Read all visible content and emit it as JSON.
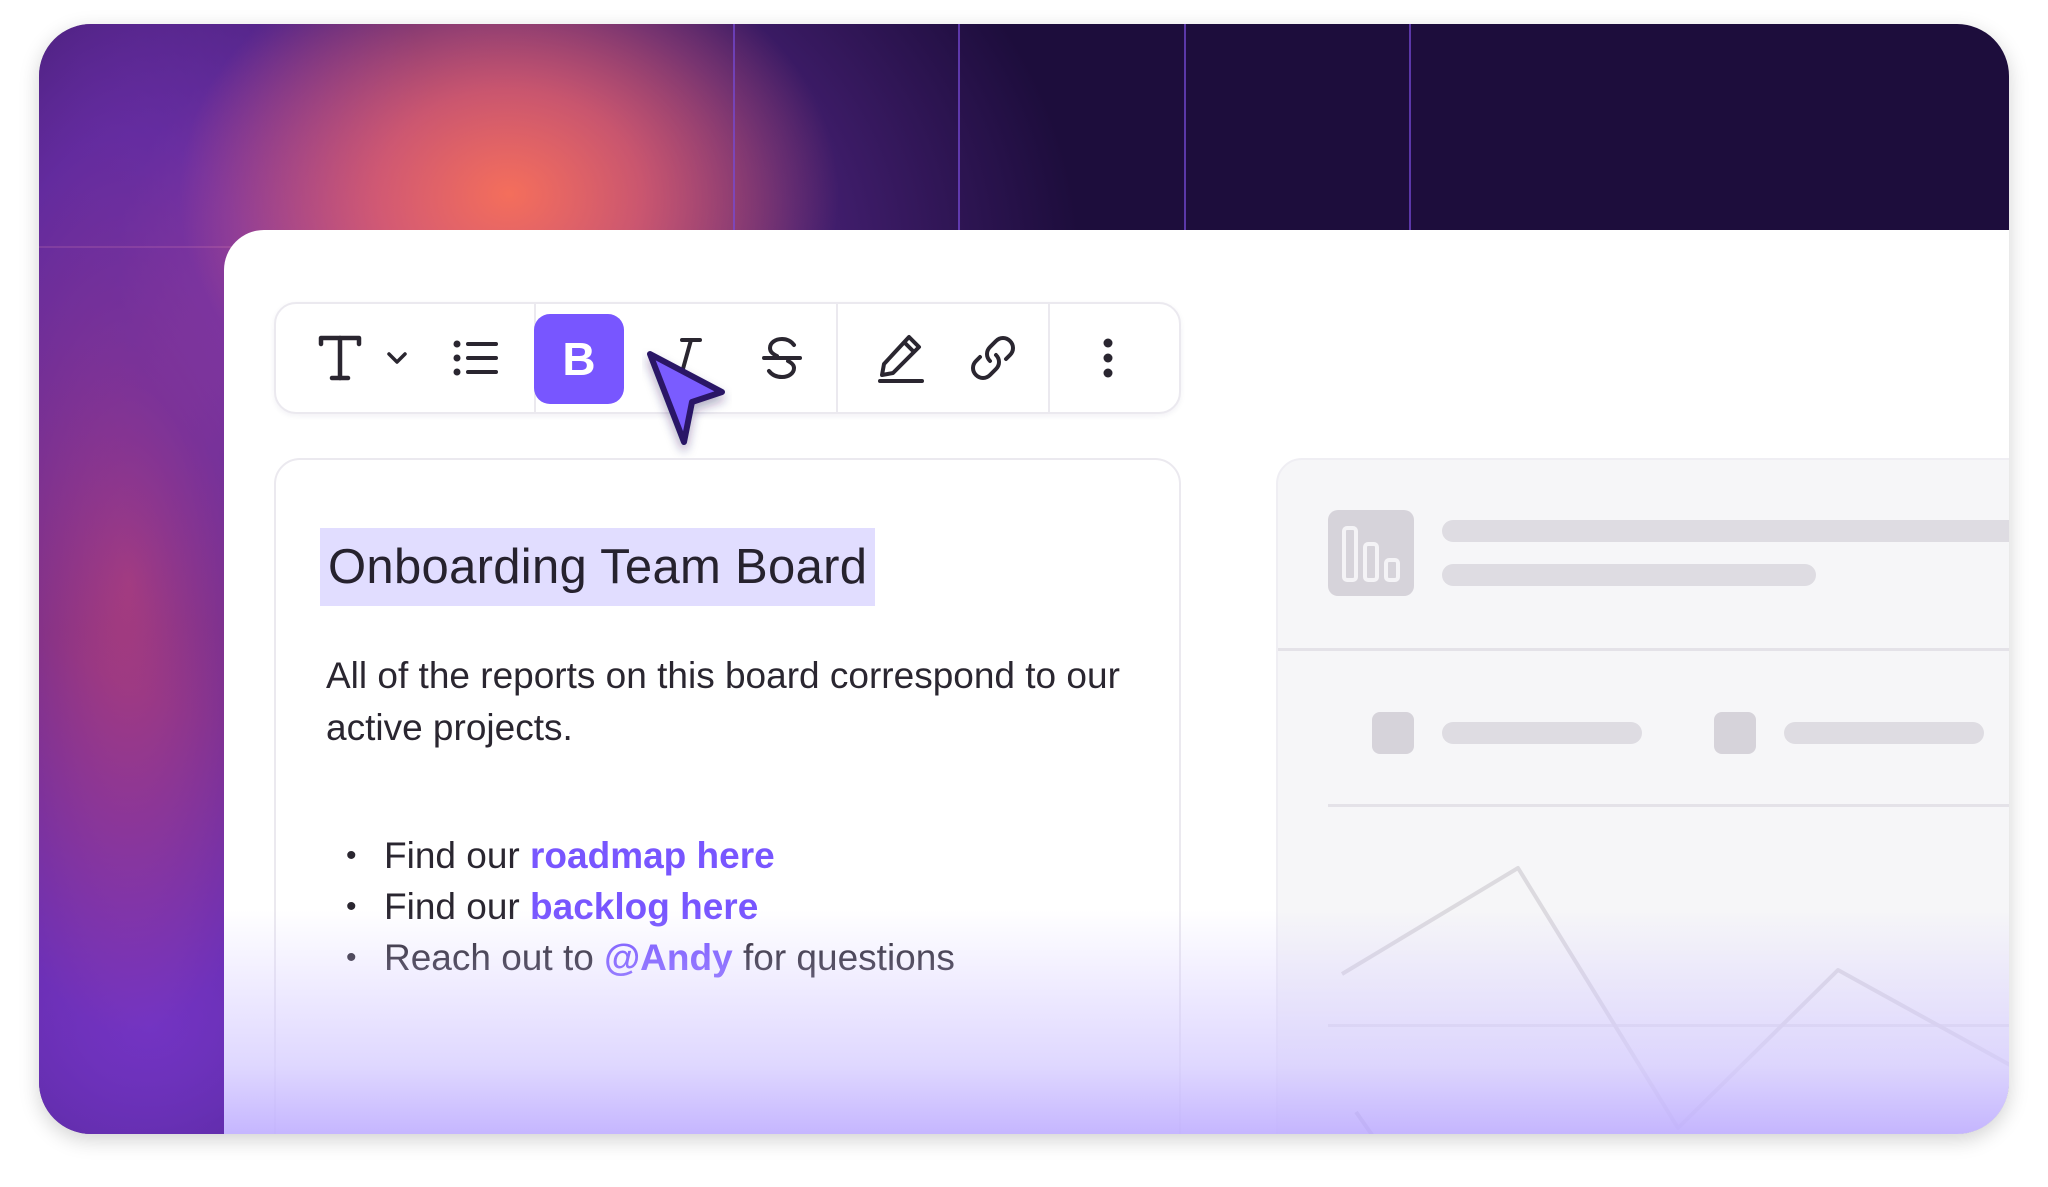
{
  "toolbar": {
    "buttons": [
      {
        "name": "text-style",
        "icon": "text-style-icon"
      },
      {
        "name": "dropdown",
        "icon": "chevron-down-icon"
      },
      {
        "name": "bullet-list",
        "icon": "bullet-list-icon"
      },
      {
        "name": "bold",
        "label": "B",
        "active": true
      },
      {
        "name": "italic",
        "icon": "italic-icon"
      },
      {
        "name": "strikethrough",
        "icon": "strikethrough-icon"
      },
      {
        "name": "highlight",
        "icon": "pen-icon"
      },
      {
        "name": "link",
        "icon": "link-icon"
      },
      {
        "name": "more",
        "icon": "more-vertical-icon"
      }
    ],
    "bold_label": "B"
  },
  "text_card": {
    "title": "Onboarding Team Board",
    "description": "All of the reports on this board correspond to our active projects.",
    "bullets": [
      {
        "prefix": "Find our ",
        "link": "roadmap here",
        "suffix": ""
      },
      {
        "prefix": "Find our ",
        "link": "backlog here",
        "suffix": ""
      },
      {
        "prefix": "Reach out to ",
        "link": "@Andy",
        "suffix": " for questions"
      }
    ]
  },
  "colors": {
    "accent": "#7856ff",
    "title_highlight": "#e1ddff",
    "background_dark": "#1d0d3c",
    "glow_coral": "#f8705a"
  }
}
